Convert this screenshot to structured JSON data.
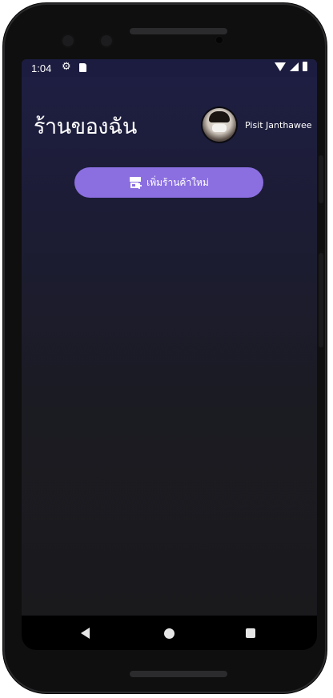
{
  "status_bar": {
    "time": "1:04",
    "icons": [
      "gear-icon",
      "sd-card-icon",
      "wifi-icon",
      "cellular-icon",
      "battery-icon"
    ]
  },
  "header": {
    "title": "ร้านของฉัน",
    "user_name": "Pisit Janthawee",
    "avatar": "avatar-photo"
  },
  "actions": {
    "add_shop_label": "เพิ่มร้านค้าใหม่",
    "add_shop_icon": "store-add-icon"
  },
  "nav": {
    "buttons": [
      "back",
      "home",
      "recents"
    ]
  },
  "colors": {
    "accent": "#8b6fe0",
    "background_top": "#1e1e44",
    "background_bottom": "#1a1a1c"
  }
}
